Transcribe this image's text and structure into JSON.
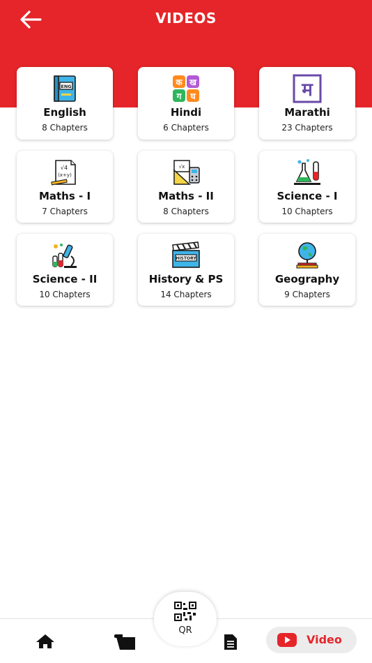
{
  "header": {
    "title": "VIDEOS"
  },
  "subjects": [
    {
      "name": "English",
      "chapters": "8 Chapters",
      "icon": "book-eng-icon"
    },
    {
      "name": "Hindi",
      "chapters": "6 Chapters",
      "icon": "hindi-letters-icon"
    },
    {
      "name": "Marathi",
      "chapters": "23 Chapters",
      "icon": "marathi-letter-icon"
    },
    {
      "name": "Maths - I",
      "chapters": "7 Chapters",
      "icon": "formula-paper-icon"
    },
    {
      "name": "Maths - II",
      "chapters": "8 Chapters",
      "icon": "geometry-tools-icon"
    },
    {
      "name": "Science - I",
      "chapters": "10 Chapters",
      "icon": "lab-flask-icon"
    },
    {
      "name": "Science - II",
      "chapters": "10 Chapters",
      "icon": "microscope-icon"
    },
    {
      "name": "History & PS",
      "chapters": "14 Chapters",
      "icon": "history-clapper-icon"
    },
    {
      "name": "Geography",
      "chapters": "9 Chapters",
      "icon": "globe-icon"
    }
  ],
  "english_icon_text": "ENG",
  "history_icon_text": "HISTORY",
  "hindi_letters": [
    "क",
    "ख",
    "ग",
    "घ"
  ],
  "marathi_letter": "म",
  "nav": {
    "qr_label": "QR",
    "video_label": "Video"
  },
  "colors": {
    "brand_red": "#e52529",
    "pill_bg": "#ececec"
  }
}
